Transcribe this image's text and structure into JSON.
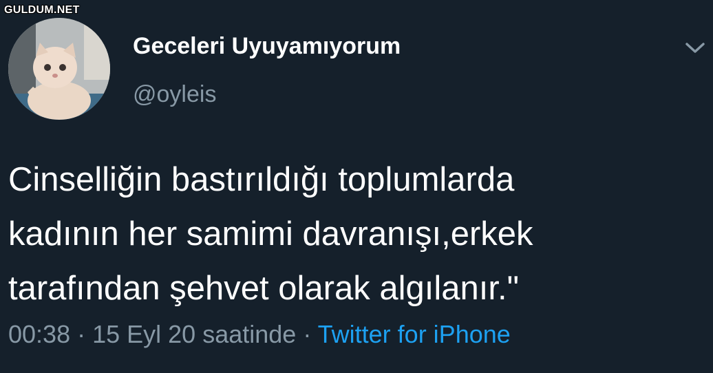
{
  "watermark": "GULDUM.NET",
  "profile": {
    "display_name": "Geceleri Uyuyamıyorum",
    "handle": "@oyleis",
    "avatar": "cat-kitten-photo"
  },
  "menu_icon": "chevron-down-icon",
  "tweet": {
    "lines": [
      "Cinselliğin bastırıldığı toplumlarda",
      "kadının her samimi davranışı,erkek",
      "tarafından şehvet olarak algılanır.\""
    ]
  },
  "meta": {
    "time": "00:38",
    "separator_1": " · ",
    "date": "15 Eyl 20 saatinde",
    "separator_2": " · ",
    "source": "Twitter for iPhone"
  },
  "colors": {
    "background": "#15202b",
    "text_primary": "#ffffff",
    "text_secondary": "#8899a6",
    "link": "#1da1f2"
  }
}
